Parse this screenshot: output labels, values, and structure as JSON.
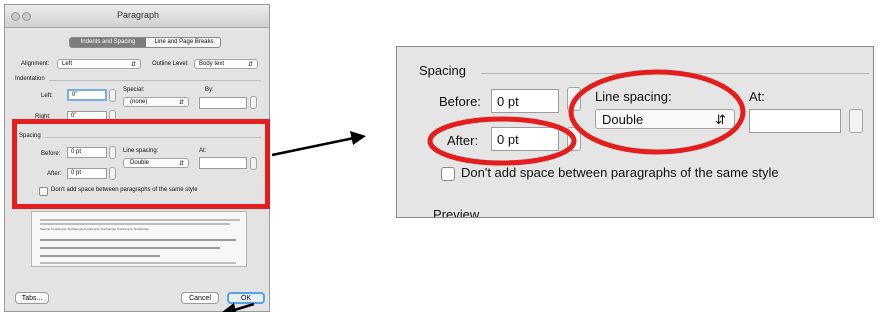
{
  "dialog": {
    "title": "Paragraph",
    "tabs": [
      "Indents and Spacing",
      "Line and Page Breaks"
    ],
    "alignment_label": "Alignment:",
    "alignment_value": "Left",
    "outline_label": "Outline Level:",
    "outline_value": "Body text",
    "indentation_label": "Indentation",
    "left_label": "Left:",
    "left_value": "0\"",
    "right_label": "Right:",
    "right_value": "0\"",
    "special_label": "Special:",
    "special_value": "(none)",
    "by_label": "By:",
    "spacing_label": "Spacing",
    "before_label": "Before:",
    "before_value": "0 pt",
    "after_label": "After:",
    "after_value": "0 pt",
    "line_spacing_label": "Line spacing:",
    "line_spacing_value": "Double",
    "at_label": "At:",
    "checkbox_label": "Don't add space between paragraphs of the same style",
    "preview_sample": "Sample TextSample TextSample TextSample TextSample TextSample TextSample",
    "tabs_button": "Tabs...",
    "cancel_button": "Cancel",
    "ok_button": "OK"
  },
  "zoom": {
    "spacing_label": "Spacing",
    "before_label": "Before:",
    "before_value": "0 pt",
    "after_label": "After:",
    "after_value": "0 pt",
    "line_spacing_label": "Line spacing:",
    "line_spacing_value": "Double",
    "at_label": "At:",
    "checkbox_label": "Don't add space between paragraphs of the same style",
    "preview_label": "Preview"
  },
  "colors": {
    "highlight": "#e41e1e",
    "ok_blue": "#5aa0e6",
    "dialog_bg": "#e3e3e3"
  }
}
